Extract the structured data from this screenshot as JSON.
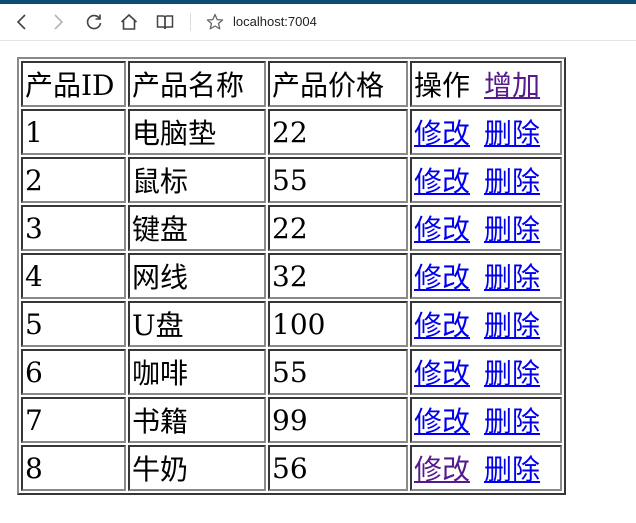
{
  "browser": {
    "url": "localhost:7004",
    "icons": [
      "back-icon",
      "forward-icon",
      "refresh-icon",
      "home-icon",
      "reading-view-icon",
      "favorite-star-icon"
    ]
  },
  "table": {
    "headers": [
      "产品ID",
      "产品名称",
      "产品价格",
      "操作"
    ],
    "add_label": "增加",
    "edit_label": "修改",
    "delete_label": "删除",
    "rows": [
      {
        "id": "1",
        "name": "电脑垫",
        "price": "22"
      },
      {
        "id": "2",
        "name": "鼠标",
        "price": "55"
      },
      {
        "id": "3",
        "name": "键盘",
        "price": "22"
      },
      {
        "id": "4",
        "name": "网线",
        "price": "32"
      },
      {
        "id": "5",
        "name": "U盘",
        "price": "100"
      },
      {
        "id": "6",
        "name": "咖啡",
        "price": "55"
      },
      {
        "id": "7",
        "name": "书籍",
        "price": "99"
      },
      {
        "id": "8",
        "name": "牛奶",
        "price": "56"
      }
    ]
  },
  "colors": {
    "link": "#0000ee",
    "visited_link": "#551a8b",
    "top_strip": "#0f4c75"
  }
}
